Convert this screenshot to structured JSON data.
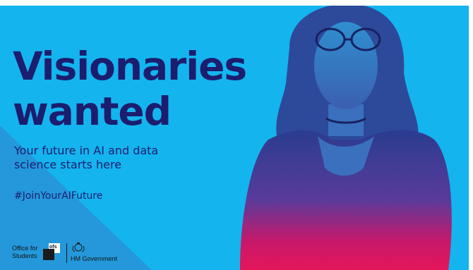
{
  "headline": {
    "line1": "Visionaries",
    "line2": "wanted"
  },
  "subline": {
    "line1": "Your future in AI and data",
    "line2": "science starts here"
  },
  "hashtag": "#JoinYourAIFuture",
  "logos": {
    "ofs": {
      "line1": "Office for",
      "line2": "Students",
      "mark": "ofs",
      "icon": "office-for-students-logo"
    },
    "hmg": {
      "text": "HM Government",
      "icon": "royal-crest-icon"
    }
  },
  "colors": {
    "background": "#14b4ef",
    "headline": "#1c1d6e",
    "person_magenta": "#e4165a",
    "person_blue": "#2a3c8f",
    "diagonal": "#2a8fd4"
  }
}
